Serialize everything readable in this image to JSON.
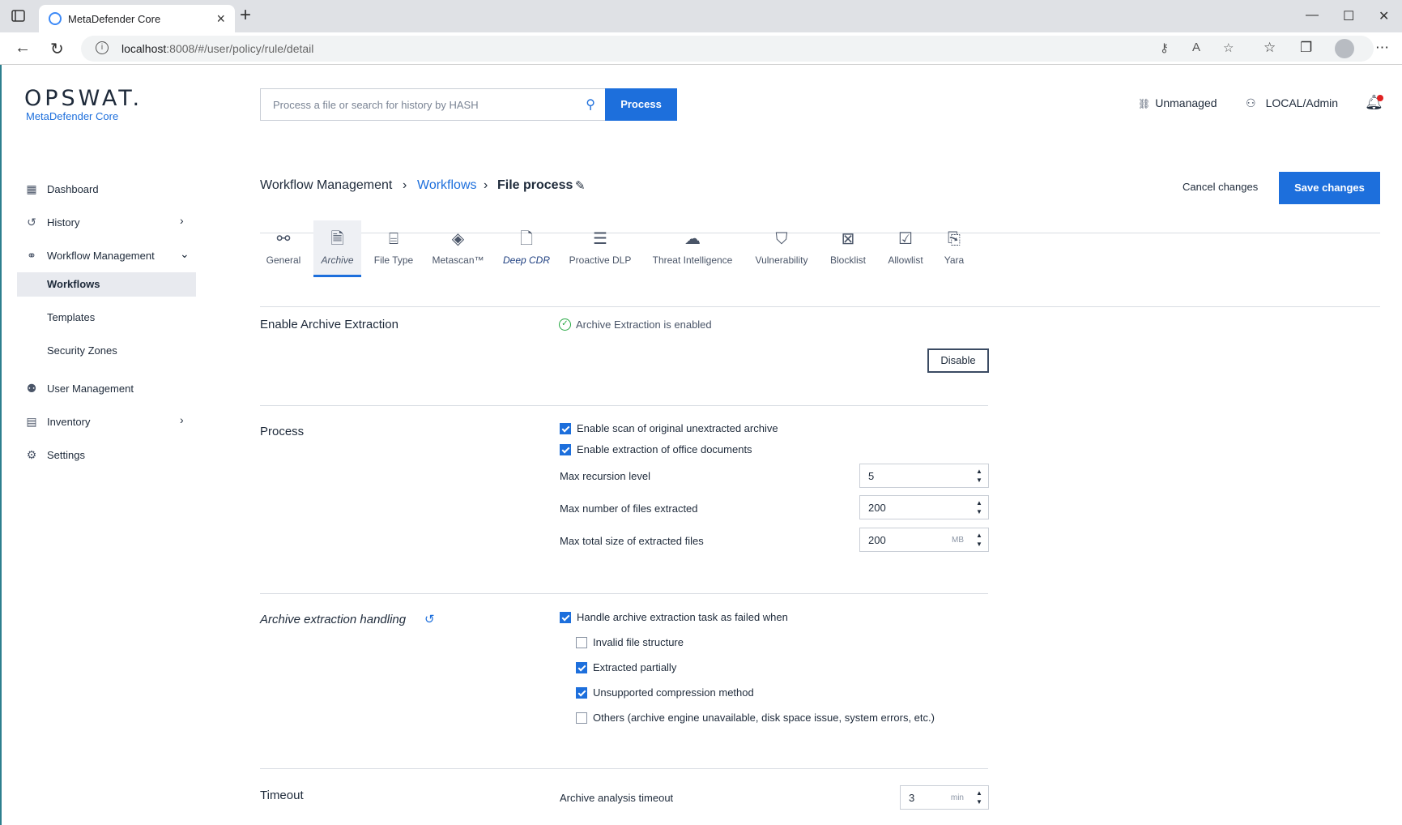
{
  "browser": {
    "tab_title": "MetaDefender Core",
    "url_host": "localhost",
    "url_rest": ":8008/#/user/policy/rule/detail"
  },
  "header": {
    "logo": "OPSWAT.",
    "product": "MetaDefender Core",
    "search_placeholder": "Process a file or search for history by HASH",
    "process_label": "Process",
    "unmanaged_label": "Unmanaged",
    "user_label": "LOCAL/Admin"
  },
  "sidebar": {
    "items": [
      {
        "label": "Dashboard",
        "icon": "grid-icon"
      },
      {
        "label": "History",
        "icon": "history-icon"
      },
      {
        "label": "Workflow Management",
        "icon": "workflow-icon"
      },
      {
        "label": "Workflows"
      },
      {
        "label": "Templates"
      },
      {
        "label": "Security Zones"
      },
      {
        "label": "User Management",
        "icon": "users-icon"
      },
      {
        "label": "Inventory",
        "icon": "inventory-icon"
      },
      {
        "label": "Settings",
        "icon": "gear-icon"
      }
    ]
  },
  "breadcrumb": {
    "root": "Workflow Management",
    "parent": "Workflows",
    "current": "File process"
  },
  "actions": {
    "cancel": "Cancel changes",
    "save": "Save changes"
  },
  "tabs": [
    {
      "label": "General",
      "icon": "general-icon"
    },
    {
      "label": "Archive",
      "icon": "archive-icon"
    },
    {
      "label": "File Type",
      "icon": "file-type-icon"
    },
    {
      "label": "Metascan™",
      "icon": "metascan-icon"
    },
    {
      "label": "Deep CDR",
      "icon": "deep-cdr-icon"
    },
    {
      "label": "Proactive DLP",
      "icon": "dlp-icon"
    },
    {
      "label": "Threat Intelligence",
      "icon": "threat-intel-icon"
    },
    {
      "label": "Vulnerability",
      "icon": "shield-icon"
    },
    {
      "label": "Blocklist",
      "icon": "blocklist-icon"
    },
    {
      "label": "Allowlist",
      "icon": "allowlist-icon"
    },
    {
      "label": "Yara",
      "icon": "yara-icon"
    }
  ],
  "archive": {
    "enable": {
      "title": "Enable Archive Extraction",
      "status": "Archive Extraction is enabled",
      "button": "Disable"
    },
    "process": {
      "title": "Process",
      "options": [
        {
          "label": "Enable scan of original unextracted archive",
          "checked": true
        },
        {
          "label": "Enable extraction of office documents",
          "checked": true
        }
      ],
      "fields": [
        {
          "label": "Max recursion level",
          "value": "5",
          "unit": ""
        },
        {
          "label": "Max number of files extracted",
          "value": "200",
          "unit": ""
        },
        {
          "label": "Max total size of extracted files",
          "value": "200",
          "unit": "MB"
        }
      ]
    },
    "handling": {
      "title": "Archive extraction handling",
      "main": {
        "label": "Handle archive extraction task as failed when",
        "checked": true
      },
      "options": [
        {
          "label": "Invalid file structure",
          "checked": false
        },
        {
          "label": "Extracted partially",
          "checked": true
        },
        {
          "label": "Unsupported compression method",
          "checked": true
        },
        {
          "label": "Others (archive engine unavailable, disk space issue, system errors, etc.)",
          "checked": false
        }
      ]
    },
    "timeout": {
      "title": "Timeout",
      "label": "Archive analysis timeout",
      "value": "3",
      "unit": "min"
    }
  }
}
